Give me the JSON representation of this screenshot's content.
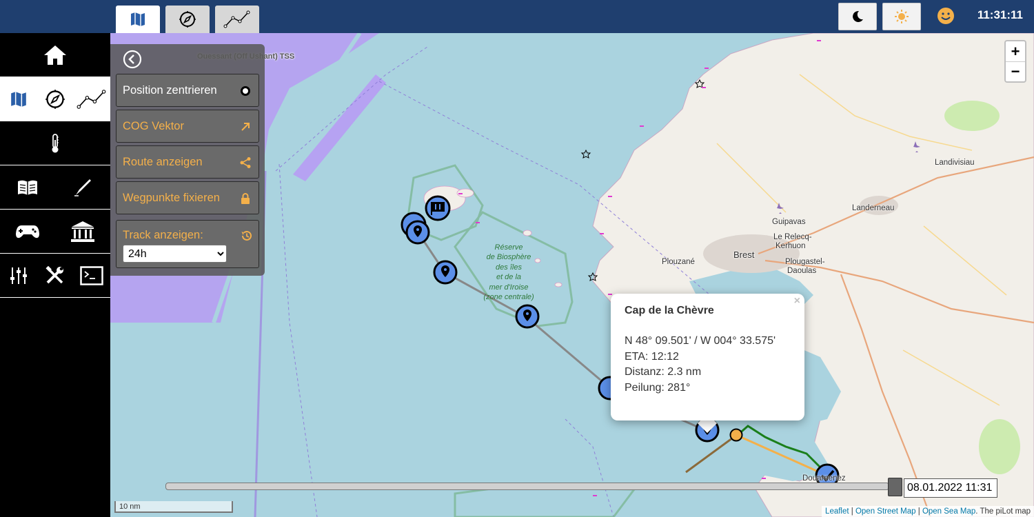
{
  "topbar": {
    "tabs": [
      {
        "icon": "map-icon",
        "active": true
      },
      {
        "icon": "compass-icon",
        "active": false
      },
      {
        "icon": "chart-line-icon",
        "active": false
      }
    ],
    "buttons": [
      {
        "icon": "moon-icon"
      },
      {
        "icon": "sun-icon"
      }
    ],
    "status_icon": "smiley-icon",
    "clock": "11:31:11"
  },
  "sidebar": {
    "rows": [
      {
        "icons": [
          "home-icon"
        ],
        "active": false
      },
      {
        "icons": [
          "map-icon",
          "compass-icon",
          "chart-line-icon"
        ],
        "active": true
      },
      {
        "icons": [
          "thermometer-icon"
        ],
        "active": false
      },
      {
        "icons": [
          "book-icon",
          "pen-icon"
        ],
        "active": false
      },
      {
        "icons": [
          "gamepad-icon",
          "bank-icon"
        ],
        "active": false
      },
      {
        "icons": [
          "sliders-icon",
          "tools-icon",
          "terminal-icon"
        ],
        "active": false
      }
    ]
  },
  "panel": {
    "back_icon": "back-circle-icon",
    "buttons": [
      {
        "label": "Position zentrieren",
        "icon": "dot-circle-icon"
      },
      {
        "label": "COG Vektor",
        "icon": "arrow-up-right-icon"
      },
      {
        "label": "Route anzeigen",
        "icon": "share-icon"
      },
      {
        "label": "Wegpunkte fixieren",
        "icon": "lock-icon"
      }
    ],
    "track": {
      "label": "Track anzeigen:",
      "icon": "history-icon",
      "value": "24h"
    }
  },
  "map": {
    "labels": {
      "tss": "Ouessant (Off Ushant) TSS",
      "reserve": [
        "Réserve",
        "de Biosphère",
        "des îles",
        "et de la",
        "mer d'Iroise",
        "(zone centrale)"
      ],
      "landivisiau": "Landivisiau",
      "landerneau": "Landerneau",
      "guipavas": "Guipavas",
      "relecq": "Le Relecq-",
      "kerhuon": "Kerhuon",
      "plouzane": "Plouzané",
      "brest": "Brest",
      "plougastel": "Plougastel-",
      "daoulas": "Daoulas",
      "douarnenez": "Douarnenez"
    },
    "colors": {
      "sea": "#aad3df",
      "land": "#f2efe9",
      "tss": "#b69ff2",
      "reserve": "#7fb89a",
      "route": "#888888",
      "waypoint": "#5b8fe8",
      "track": "#1b7f1b",
      "cog": "#8b6a3a",
      "boat": "#f4b04a"
    }
  },
  "zoom": {
    "in": "+",
    "out": "−"
  },
  "popup": {
    "close": "×",
    "title": "Cap de la Chèvre",
    "position": "N 48° 09.501' / W 004° 33.575'",
    "eta": "ETA: 12:12",
    "distance": "Distanz: 2.3 nm",
    "bearing": "Peilung: 281°"
  },
  "slider": {
    "date": "08.01.2022 11:31"
  },
  "scale": "10 nm",
  "attribution": {
    "leaflet": "Leaflet",
    "osm": "Open Street Map",
    "osea": "Open Sea Map",
    "suffix": ". The piLot map"
  }
}
